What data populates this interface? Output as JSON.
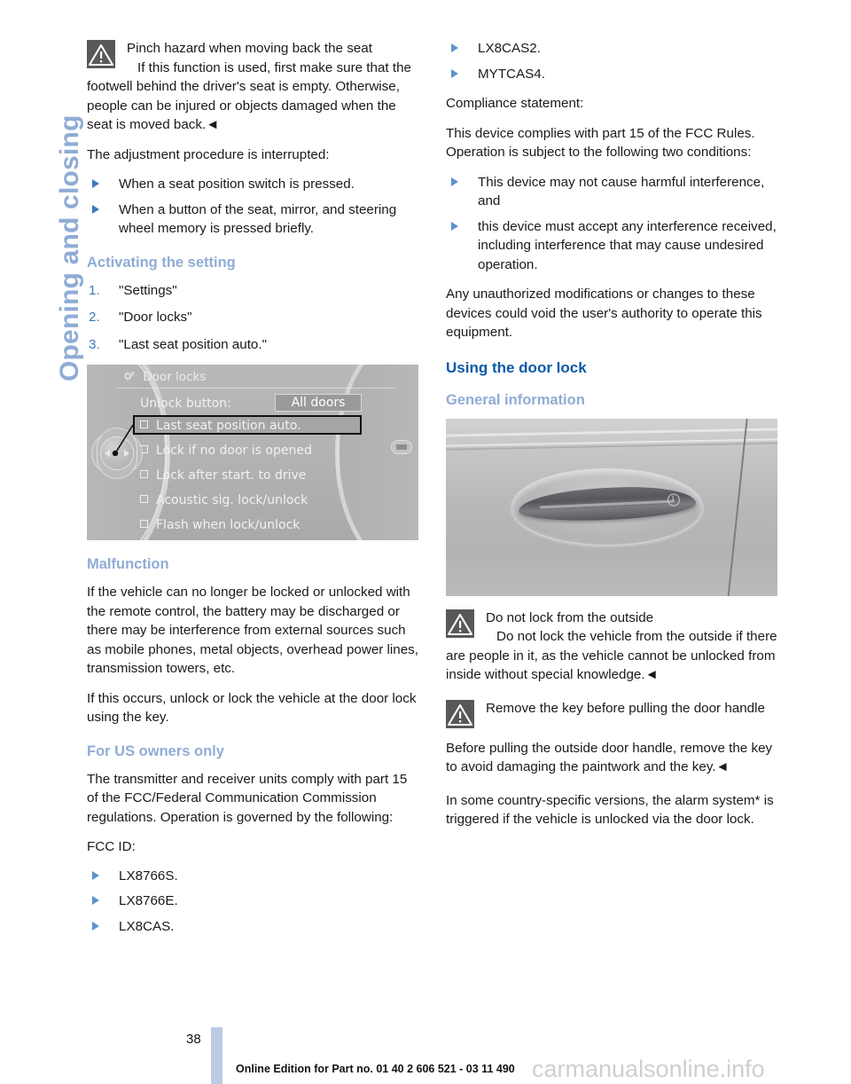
{
  "chapter": {
    "title": "Opening and closing"
  },
  "left_column": {
    "warning_pinch": {
      "icon": "warning-triangle-icon",
      "heading": "Pinch hazard when moving back the seat",
      "body": "If this function is used, first make sure that the footwell behind the driver's seat is empty. Otherwise, people can be injured or objects damaged when the seat is moved back.◄"
    },
    "interrupt_intro": "The adjustment procedure is interrupted:",
    "interrupt_bullets": [
      "When a seat position switch is pressed.",
      "When a button of the seat, mirror, and steering wheel memory is pressed briefly."
    ],
    "activating_heading": "Activating the setting",
    "activating_steps": [
      {
        "number": "1.",
        "text": "\"Settings\""
      },
      {
        "number": "2.",
        "text": "\"Door locks\""
      },
      {
        "number": "3.",
        "text": "\"Last seat position auto.\""
      }
    ],
    "idrive_screen": {
      "menu_title": "Door locks",
      "menu_icon": "settings-gear-icon",
      "field_label": "Unlock button:",
      "field_value": "All doors",
      "options": [
        "Last seat position auto.",
        "Lock if no door is opened",
        "Lock after start. to drive",
        "Acoustic sig. lock/unlock",
        "Flash when lock/unlock"
      ],
      "selected_option": "Last seat position auto."
    },
    "malfunction_heading": "Malfunction",
    "malfunction_p1": "If the vehicle can no longer be locked or unlocked with the remote control, the battery may be discharged or there may be interference from external sources such as mobile phones, metal objects, overhead power lines, transmission towers, etc.",
    "malfunction_p2": "If this occurs, unlock or lock the vehicle at the door lock using the key.",
    "us_owners_heading": "For US owners only",
    "us_owners_p1": "The transmitter and receiver units comply with part 15 of the FCC/Federal Communication Commission regulations. Operation is governed by the following:",
    "fcc_id_label": "FCC ID:",
    "fcc_ids": [
      "LX8766S.",
      "LX8766E.",
      "LX8CAS."
    ]
  },
  "right_column": {
    "fcc_ids_cont": [
      "LX8CAS2.",
      "MYTCAS4."
    ],
    "compliance_label": "Compliance statement:",
    "compliance_intro": "This device complies with part 15 of the FCC Rules. Operation is subject to the following two conditions:",
    "compliance_bullets": [
      "This device may not cause harmful interference, and",
      "this device must accept any interference received, including interference that may cause undesired operation."
    ],
    "unauthorized_p": "Any unauthorized modifications or changes to these devices could void the user's authority to operate this equipment.",
    "using_door_lock_heading": "Using the door lock",
    "general_info_heading": "General information",
    "door_photo": {
      "alt": "exterior door handle with lock cylinder"
    },
    "warning_outside": {
      "icon": "warning-triangle-icon",
      "heading": "Do not lock from the outside",
      "body": "Do not lock the vehicle from the outside if there are people in it, as the vehicle cannot be unlocked from inside without special knowledge.◄"
    },
    "warning_remove_key": {
      "icon": "warning-triangle-icon",
      "heading": "Remove the key before pulling the door handle",
      "body": "Before pulling the outside door handle, remove the key to avoid damaging the paintwork and the key.◄"
    },
    "alarm_note": "In some country-specific versions, the alarm system* is triggered if the vehicle is unlocked via the door lock."
  },
  "footer": {
    "page_number": "38",
    "note": "Online Edition for Part no. 01 40 2 606 521 - 03 11 490",
    "watermark": "carmanualsonline.info"
  },
  "colors": {
    "heading_dark_blue": "#0B59A8",
    "heading_light_blue": "#8FACD6",
    "bullet_blue": "#3E78BE",
    "warning_icon_bg": "#58585A",
    "page_bar": "#BACBE4"
  }
}
